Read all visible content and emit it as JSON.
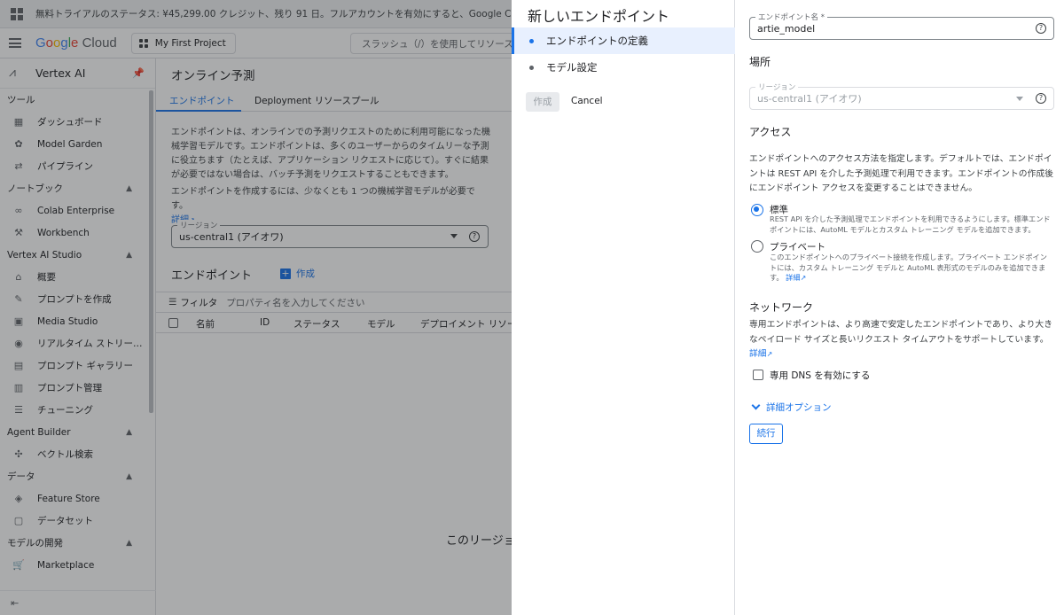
{
  "trial": {
    "text": "無料トライアルのステータス: ¥45,299.00 クレジット、残り 91 日。フルアカウントを有効にすると、Google Cloud のすべて"
  },
  "topbar": {
    "logo_google": [
      "G",
      "o",
      "o",
      "g",
      "l",
      "e"
    ],
    "logo_cloud": "Cloud",
    "project": "My First Project",
    "search_placeholder": "スラッシュ（/）を使用してリソース、"
  },
  "sidebar": {
    "product": "Vertex AI",
    "sections": [
      {
        "title": "ツール",
        "collapsible": false,
        "items": [
          {
            "label": "ダッシュボード",
            "icon": "dashboard-icon",
            "glyph": "▦"
          },
          {
            "label": "Model Garden",
            "icon": "model-garden-icon",
            "glyph": "✿"
          },
          {
            "label": "パイプライン",
            "icon": "pipeline-icon",
            "glyph": "⇄"
          }
        ]
      },
      {
        "title": "ノートブック",
        "collapsible": true,
        "items": [
          {
            "label": "Colab Enterprise",
            "icon": "colab-icon",
            "glyph": "∞"
          },
          {
            "label": "Workbench",
            "icon": "workbench-icon",
            "glyph": "⚒"
          }
        ]
      },
      {
        "title": "Vertex AI Studio",
        "collapsible": true,
        "items": [
          {
            "label": "概要",
            "icon": "home-icon",
            "glyph": "⌂"
          },
          {
            "label": "プロンプトを作成",
            "icon": "prompt-create-icon",
            "glyph": "✎"
          },
          {
            "label": "Media Studio",
            "icon": "media-icon",
            "glyph": "▣"
          },
          {
            "label": "リアルタイム ストリー…",
            "icon": "stream-icon",
            "glyph": "◉"
          },
          {
            "label": "プロンプト ギャラリー",
            "icon": "gallery-icon",
            "glyph": "▤"
          },
          {
            "label": "プロンプト管理",
            "icon": "prompt-manage-icon",
            "glyph": "▥"
          },
          {
            "label": "チューニング",
            "icon": "tuning-icon",
            "glyph": "☰"
          }
        ]
      },
      {
        "title": "Agent Builder",
        "collapsible": true,
        "items": [
          {
            "label": "ベクトル検索",
            "icon": "vector-icon",
            "glyph": "✣"
          }
        ]
      },
      {
        "title": "データ",
        "collapsible": true,
        "items": [
          {
            "label": "Feature Store",
            "icon": "feature-store-icon",
            "glyph": "◈"
          },
          {
            "label": "データセット",
            "icon": "dataset-icon",
            "glyph": "▢"
          }
        ]
      },
      {
        "title": "モデルの開発",
        "collapsible": true,
        "items": [
          {
            "label": "Marketplace",
            "icon": "marketplace-icon",
            "glyph": "🛒"
          }
        ]
      }
    ]
  },
  "main": {
    "title": "オンライン予測",
    "tabs": [
      "エンドポイント",
      "Deployment リソースプール"
    ],
    "desc1": "エンドポイントは、オンラインでの予測リクエストのために利用可能になった機械学習モデルです。エンドポイントは、多くのユーザーからのタイムリーな予測に役立ちます（たとえば、アプリケーション リクエストに応じて）。すぐに結果が必要ではない場合は、バッチ予測をリクエストすることもできます。",
    "desc2": "エンドポイントを作成するには、少なくとも 1 つの機械学習モデルが必要です。",
    "desc2_link": "詳細",
    "region_label": "リージョン",
    "region_value": "us-central1 (アイオワ)",
    "endpoints_heading": "エンドポイント",
    "create_label": "作成",
    "filter_label": "フィルタ",
    "filter_placeholder": "プロパティ名を入力してください",
    "columns": [
      "名前",
      "ID",
      "ステータス",
      "モデル",
      "デプロイメント リソース"
    ],
    "empty_text": "このリージョ"
  },
  "panel": {
    "title": "新しいエンドポイント",
    "steps": [
      "エンドポイントの定義",
      "モデル設定"
    ],
    "create_button": "作成",
    "cancel_button": "Cancel",
    "name_label": "エンドポイント名 *",
    "name_value": "artie_model",
    "location_heading": "場所",
    "region_label": "リージョン",
    "region_value": "us-central1 (アイオワ)",
    "access_heading": "アクセス",
    "access_desc": "エンドポイントへのアクセス方法を指定します。デフォルトでは、エンドポイントは REST API を介した予測処理で利用できます。エンドポイントの作成後にエンドポイント アクセスを変更することはできません。",
    "standard_label": "標準",
    "standard_desc": "REST API を介した予測処理でエンドポイントを利用できるようにします。標準エンドポイントには、AutoML モデルとカスタム トレーニング モデルを追加できます。",
    "private_label": "プライベート",
    "private_desc": "このエンドポイントへのプライベート接続を作成します。プライベート エンドポイントには、カスタム トレーニング モデルと AutoML 表形式のモデルのみを追加できます。",
    "private_link": "詳細",
    "network_heading": "ネットワーク",
    "network_desc": "専用エンドポイントは、より高速で安定したエンドポイントであり、より大きなペイロード サイズと長いリクエスト タイムアウトをサポートしています。",
    "network_link": "詳細",
    "dns_label": "専用 DNS を有効にする",
    "advanced_label": "詳細オプション",
    "continue_button": "続行"
  },
  "colors": {
    "accent": "#1a73e8",
    "scrim": "rgba(32,33,36,0.38)"
  }
}
